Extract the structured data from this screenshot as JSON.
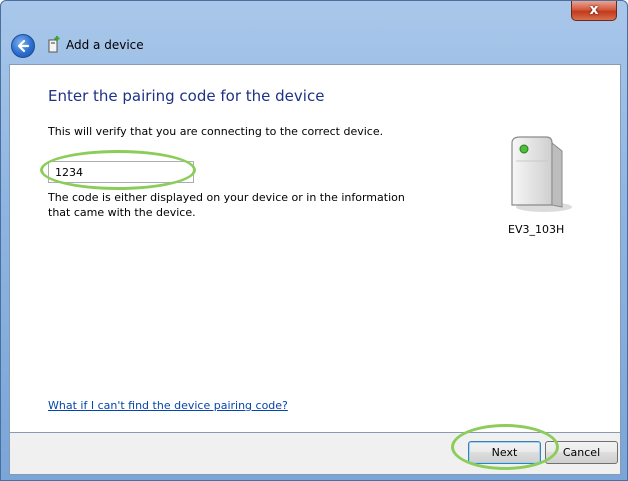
{
  "window": {
    "close_glyph": "x"
  },
  "navbar": {
    "back_icon": "back-arrow-icon",
    "wizard_icon": "add-device-icon",
    "title": "Add a device"
  },
  "main": {
    "heading": "Enter the pairing code for the device",
    "description": "This will verify that you are connecting to the correct device.",
    "code_input_value": "1234",
    "help_text": "The code is either displayed on your device or in the information that came with the device.",
    "device": {
      "icon": "device-tower-icon",
      "name": "EV3_103H"
    },
    "help_link": "What if I can't find the device pairing code?"
  },
  "footer": {
    "next_label": "Next",
    "cancel_label": "Cancel"
  },
  "colors": {
    "heading": "#1e3287",
    "link": "#0645ad",
    "highlight": "#8ccd5a"
  }
}
